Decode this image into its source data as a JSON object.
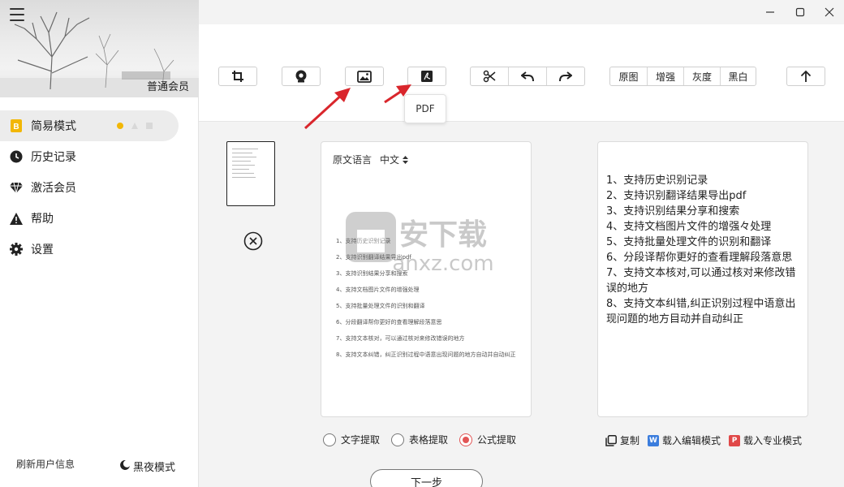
{
  "sidebar": {
    "member_label": "普通会员",
    "nav": [
      {
        "label": "简易模式",
        "icon": "b-badge-icon"
      },
      {
        "label": "历史记录",
        "icon": "clock-icon"
      },
      {
        "label": "激活会员",
        "icon": "diamond-icon"
      },
      {
        "label": "帮助",
        "icon": "warning-icon"
      },
      {
        "label": "设置",
        "icon": "gear-icon"
      }
    ],
    "refresh_label": "刷新用户信息",
    "night_mode_label": "黑夜模式"
  },
  "toolbar": {
    "filters": [
      "原图",
      "增强",
      "灰度",
      "黑白"
    ],
    "tooltip": "PDF"
  },
  "source": {
    "lang_label": "原文语言",
    "lang_value": "中文",
    "doc_lines": [
      "1、支持历史识别记录",
      "2、支持识别翻译结果导出pdf",
      "3、支持识别结果分享和搜索",
      "4、支持文档图片文件的增强处理",
      "5、支持批量处理文件的识别和翻译",
      "6、分段翻译帮你更好的查看理解段落意思",
      "7、支持文本核对，可以通过核对来修改错误的地方",
      "8、支持文本纠错，纠正识别过程中语意出现问题的地方自动并自动纠正"
    ]
  },
  "watermark": {
    "title": "安下载",
    "domain": "anxz.com"
  },
  "result": {
    "lines": [
      "1、支持历史识别记录",
      "2、支持识别翻译结果导出pdf",
      "3、支持识别结果分享和搜索",
      "4、支持文档图片文件的增强々处理",
      "5、支持批量处理文件的识别和翻译",
      "6、分段译帮你更好的查看理解段落意思",
      "7、支持文本核对,可以通过核对来修改错误的地方",
      "8、支持文本纠错,纠正识别过程中语意出现问题的地方目动并自动纠正"
    ]
  },
  "extract": {
    "options": [
      "文字提取",
      "表格提取",
      "公式提取"
    ],
    "selected": "公式提取"
  },
  "actions": {
    "copy": "复制",
    "edit_mode": "载入编辑模式",
    "pro_mode": "载入专业模式",
    "edit_badge": "W",
    "pro_badge": "P"
  },
  "next_label": "下一步",
  "colors": {
    "accent": "#e25555",
    "active_dot": "#f2b705",
    "word_blue": "#3b7ddd",
    "pro_red": "#e04848",
    "arrow_red": "#d9262c"
  }
}
